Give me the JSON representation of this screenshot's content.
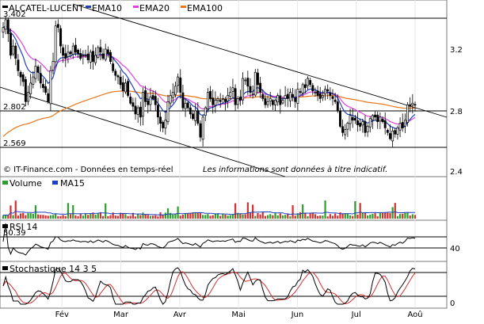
{
  "chart_data": {
    "type": "candlestick",
    "price": {
      "legend": [
        {
          "name": "ALCATEL-LUCENT",
          "color": "#000000"
        },
        {
          "name": "EMA10",
          "color": "#1f3fbf"
        },
        {
          "name": "EMA20",
          "color": "#e040e0"
        },
        {
          "name": "EMA100",
          "color": "#e8761a"
        }
      ],
      "ylim": [
        2.4,
        3.5
      ],
      "y_ticks": [
        "3.2",
        "2.8",
        "2.4"
      ],
      "levels": [
        "3.402",
        "2.802",
        "2.569"
      ],
      "footer_left": "© IT-Finance.com - Données en temps-réel",
      "footer_right": "Les informations sont données à titre indicatif."
    },
    "volume": {
      "legend": [
        {
          "name": "Volume",
          "color": "#2aa02a"
        },
        {
          "name": "MA15",
          "color": "#1f3fbf"
        }
      ]
    },
    "rsi": {
      "legend": [
        {
          "name": "RSI 14",
          "color": "#000000"
        }
      ],
      "ylim": [
        0,
        100
      ],
      "y_ticks": [
        "40"
      ],
      "level": "50.39"
    },
    "stochastic": {
      "legend": [
        {
          "name": "Stochastique 14 3 5",
          "color": "#000000"
        }
      ],
      "ylim": [
        0,
        100
      ],
      "y_ticks": [
        "0"
      ]
    },
    "x_labels": [
      "Fév",
      "Mar",
      "Avr",
      "Mai",
      "Jun",
      "Jul",
      "Aoû"
    ],
    "x_label_days": [
      26,
      52,
      78,
      104,
      130,
      156,
      182
    ],
    "close": [
      3.34,
      3.39,
      3.3,
      3.16,
      3.22,
      3.14,
      3.06,
      3.02,
      2.99,
      2.86,
      2.92,
      2.98,
      3.02,
      3.09,
      3.05,
      2.98,
      2.95,
      2.92,
      2.86,
      3.06,
      3.12,
      3.35,
      3.34,
      3.22,
      3.16,
      3.14,
      3.18,
      3.17,
      3.22,
      3.18,
      3.17,
      3.14,
      3.16,
      3.16,
      3.13,
      3.18,
      3.12,
      3.16,
      3.21,
      3.18,
      3.14,
      3.2,
      3.17,
      3.12,
      3.06,
      3.03,
      3.02,
      2.97,
      2.93,
      2.98,
      2.9,
      2.85,
      2.83,
      2.78,
      2.82,
      2.76,
      2.92,
      2.86,
      2.84,
      2.89,
      2.88,
      2.84,
      2.76,
      2.72,
      2.69,
      2.74,
      2.86,
      2.9,
      2.92,
      2.96,
      3.02,
      2.92,
      2.82,
      2.85,
      2.82,
      2.78,
      2.75,
      2.8,
      2.72,
      2.63,
      2.76,
      2.82,
      2.92,
      2.88,
      2.84,
      2.87,
      2.88,
      2.86,
      2.88,
      2.86,
      2.9,
      2.92,
      2.95,
      2.84,
      2.88,
      2.87,
      3.01,
      3.0,
      2.96,
      2.92,
      2.91,
      3.05,
      2.97,
      2.92,
      2.88,
      2.84,
      2.86,
      2.88,
      2.84,
      2.87,
      2.9,
      2.84,
      2.87,
      2.9,
      2.88,
      2.92,
      2.89,
      2.86,
      2.94,
      2.92,
      2.97,
      2.95,
      3.01,
      2.97,
      2.93,
      2.92,
      2.9,
      2.88,
      2.9,
      2.94,
      2.93,
      2.9,
      2.88,
      2.86,
      2.8,
      2.7,
      2.66,
      2.68,
      2.72,
      2.77,
      2.74,
      2.74,
      2.71,
      2.7,
      2.73,
      2.66,
      2.7,
      2.75,
      2.77,
      2.76,
      2.73,
      2.76,
      2.73,
      2.69,
      2.66,
      2.62,
      2.67,
      2.65,
      2.69,
      2.72,
      2.69,
      2.74,
      2.84,
      2.83,
      2.85,
      2.84
    ]
  }
}
